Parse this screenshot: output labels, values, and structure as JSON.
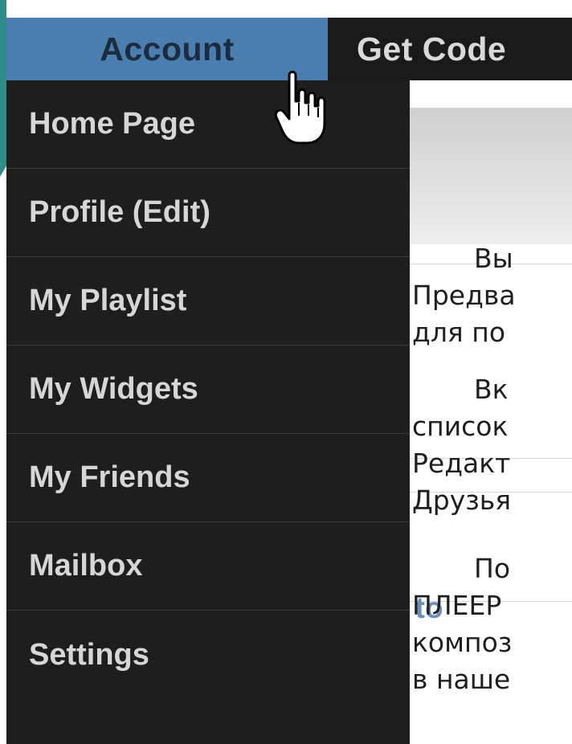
{
  "nav": {
    "account_label": "Account",
    "get_code_label": "Get Code"
  },
  "menu": {
    "items": [
      {
        "label": "Home Page"
      },
      {
        "label": "Profile (Edit)"
      },
      {
        "label": "My Playlist"
      },
      {
        "label": "My Widgets"
      },
      {
        "label": "My Friends"
      },
      {
        "label": "Mailbox"
      },
      {
        "label": "Settings"
      }
    ]
  },
  "content": {
    "lines": [
      "Вы",
      "Предва",
      "для по",
      "Вк",
      "список",
      "Редакт",
      "Друзья",
      "По",
      "ПЛЕЕР",
      "композ",
      "в наше"
    ],
    "background_link": "ends to"
  },
  "colors": {
    "account_tab": "#4a7db0",
    "menu_bg": "#1e1e1e",
    "accent_teal": "#2f8d8a"
  },
  "icons": {
    "cursor": "hand-pointer-icon"
  }
}
